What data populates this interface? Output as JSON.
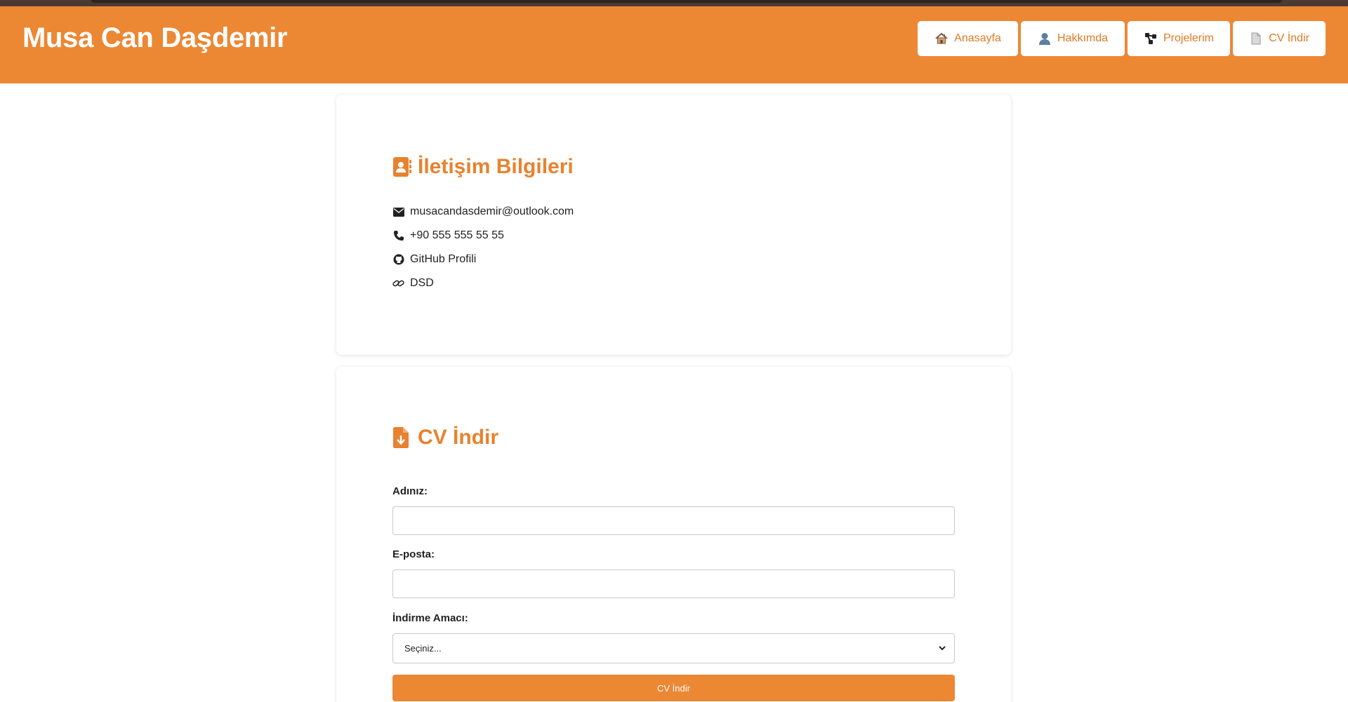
{
  "header": {
    "title": "Musa Can Daşdemir",
    "nav": {
      "home": {
        "label": "Anasayfa",
        "icon": "house-icon"
      },
      "about": {
        "label": "Hakkımda",
        "icon": "person-icon"
      },
      "projects": {
        "label": "Projelerim",
        "icon": "share-nodes-icon"
      },
      "cv": {
        "label": "CV İndir",
        "icon": "document-icon"
      }
    }
  },
  "contact": {
    "title": "İletişim Bilgileri",
    "items": [
      {
        "icon": "envelope-icon",
        "text": "musacandasdemir@outlook.com"
      },
      {
        "icon": "phone-icon",
        "text": "+90 555 555 55 55"
      },
      {
        "icon": "github-icon",
        "text": "GitHub Profili"
      },
      {
        "icon": "link-icon",
        "text": "DSD"
      }
    ]
  },
  "cv_form": {
    "title": "CV İndir",
    "name_label": "Adınız:",
    "name_value": "",
    "email_label": "E-posta:",
    "email_value": "",
    "purpose_label": "İndirme Amacı:",
    "purpose_selected": "Seçiniz...",
    "submit_label": "CV İndir"
  },
  "colors": {
    "accent": "#ec8734",
    "accent_text": "#e8822e",
    "header_strip": "#4a3a33"
  }
}
